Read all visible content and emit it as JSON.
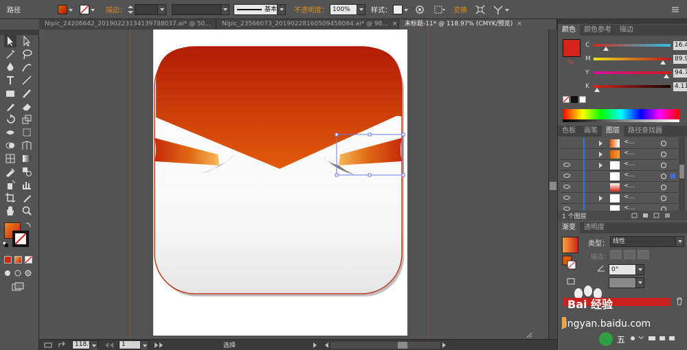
{
  "control_bar": {
    "object_type": "路径",
    "stroke_label": "描边：",
    "stroke_profile": "基本",
    "opacity_label": "不透明度：",
    "opacity_value": "100%",
    "style_label": "样式：",
    "transform_label": "变换"
  },
  "document_tabs": [
    {
      "label": "Nipic_24206642_20190223134139788037.ai* @ 50...",
      "close": "×",
      "active": false
    },
    {
      "label": "Nipic_23566073_20190228160509458084.ai* @ 98...",
      "close": "×",
      "active": false
    },
    {
      "label": "未标题-11* @ 118.97% (CMYK/预览)",
      "close": "×",
      "active": true
    }
  ],
  "color_panel": {
    "tabs": [
      "颜色",
      "颜色参考",
      "描边"
    ],
    "channels": [
      {
        "label": "C",
        "value": "16.48",
        "fraction": 0.165,
        "gradient": "linear-gradient(90deg,#d02b1d,#27c5e8)"
      },
      {
        "label": "M",
        "value": "89.9",
        "fraction": 0.899,
        "gradient": "linear-gradient(90deg,#e6e21a,#c3131c)"
      },
      {
        "label": "Y",
        "value": "94.77",
        "fraction": 0.948,
        "gradient": "linear-gradient(90deg,#d0129a,#d31a1a)"
      },
      {
        "label": "K",
        "value": "4.11",
        "fraction": 0.041,
        "gradient": "linear-gradient(90deg,#d3271d,#1a0202)"
      }
    ],
    "fill_color": "#d3251a",
    "fill_unicode": "%"
  },
  "layers_panel": {
    "tabs": [
      "色板",
      "画笔",
      "图层",
      "路径查找器"
    ],
    "rows": [
      {
        "name": "<...",
        "eye": false,
        "expand": true
      },
      {
        "name": "<...",
        "eye": false,
        "expand": true
      },
      {
        "name": "<...",
        "eye": true,
        "expand": true
      },
      {
        "name": "<...",
        "eye": true,
        "expand": false
      },
      {
        "name": "<...",
        "eye": true,
        "expand": false
      },
      {
        "name": "<...",
        "eye": true,
        "expand": true
      },
      {
        "name": "<...",
        "eye": true,
        "expand": false
      }
    ],
    "footer": "1 个图层"
  },
  "gradient_panel": {
    "tabs": [
      "渐变",
      "透明度"
    ],
    "type_label": "类型：",
    "type_value": "线性",
    "stroke_label": "描边：",
    "angle_value": "0°"
  },
  "watermark": {
    "text": "Bai 经验",
    "url": "jingyan.baidu.com"
  },
  "status_bar": {
    "zoom": "118.97",
    "page": "1",
    "tool": "选择"
  },
  "colors": {
    "accent_orange": "#e08a1e",
    "guide_red": "#c43030",
    "icon_red_top": "#b11c05",
    "icon_red_bottom": "#e25b0b",
    "ribbon_light": "#f5a23a"
  }
}
